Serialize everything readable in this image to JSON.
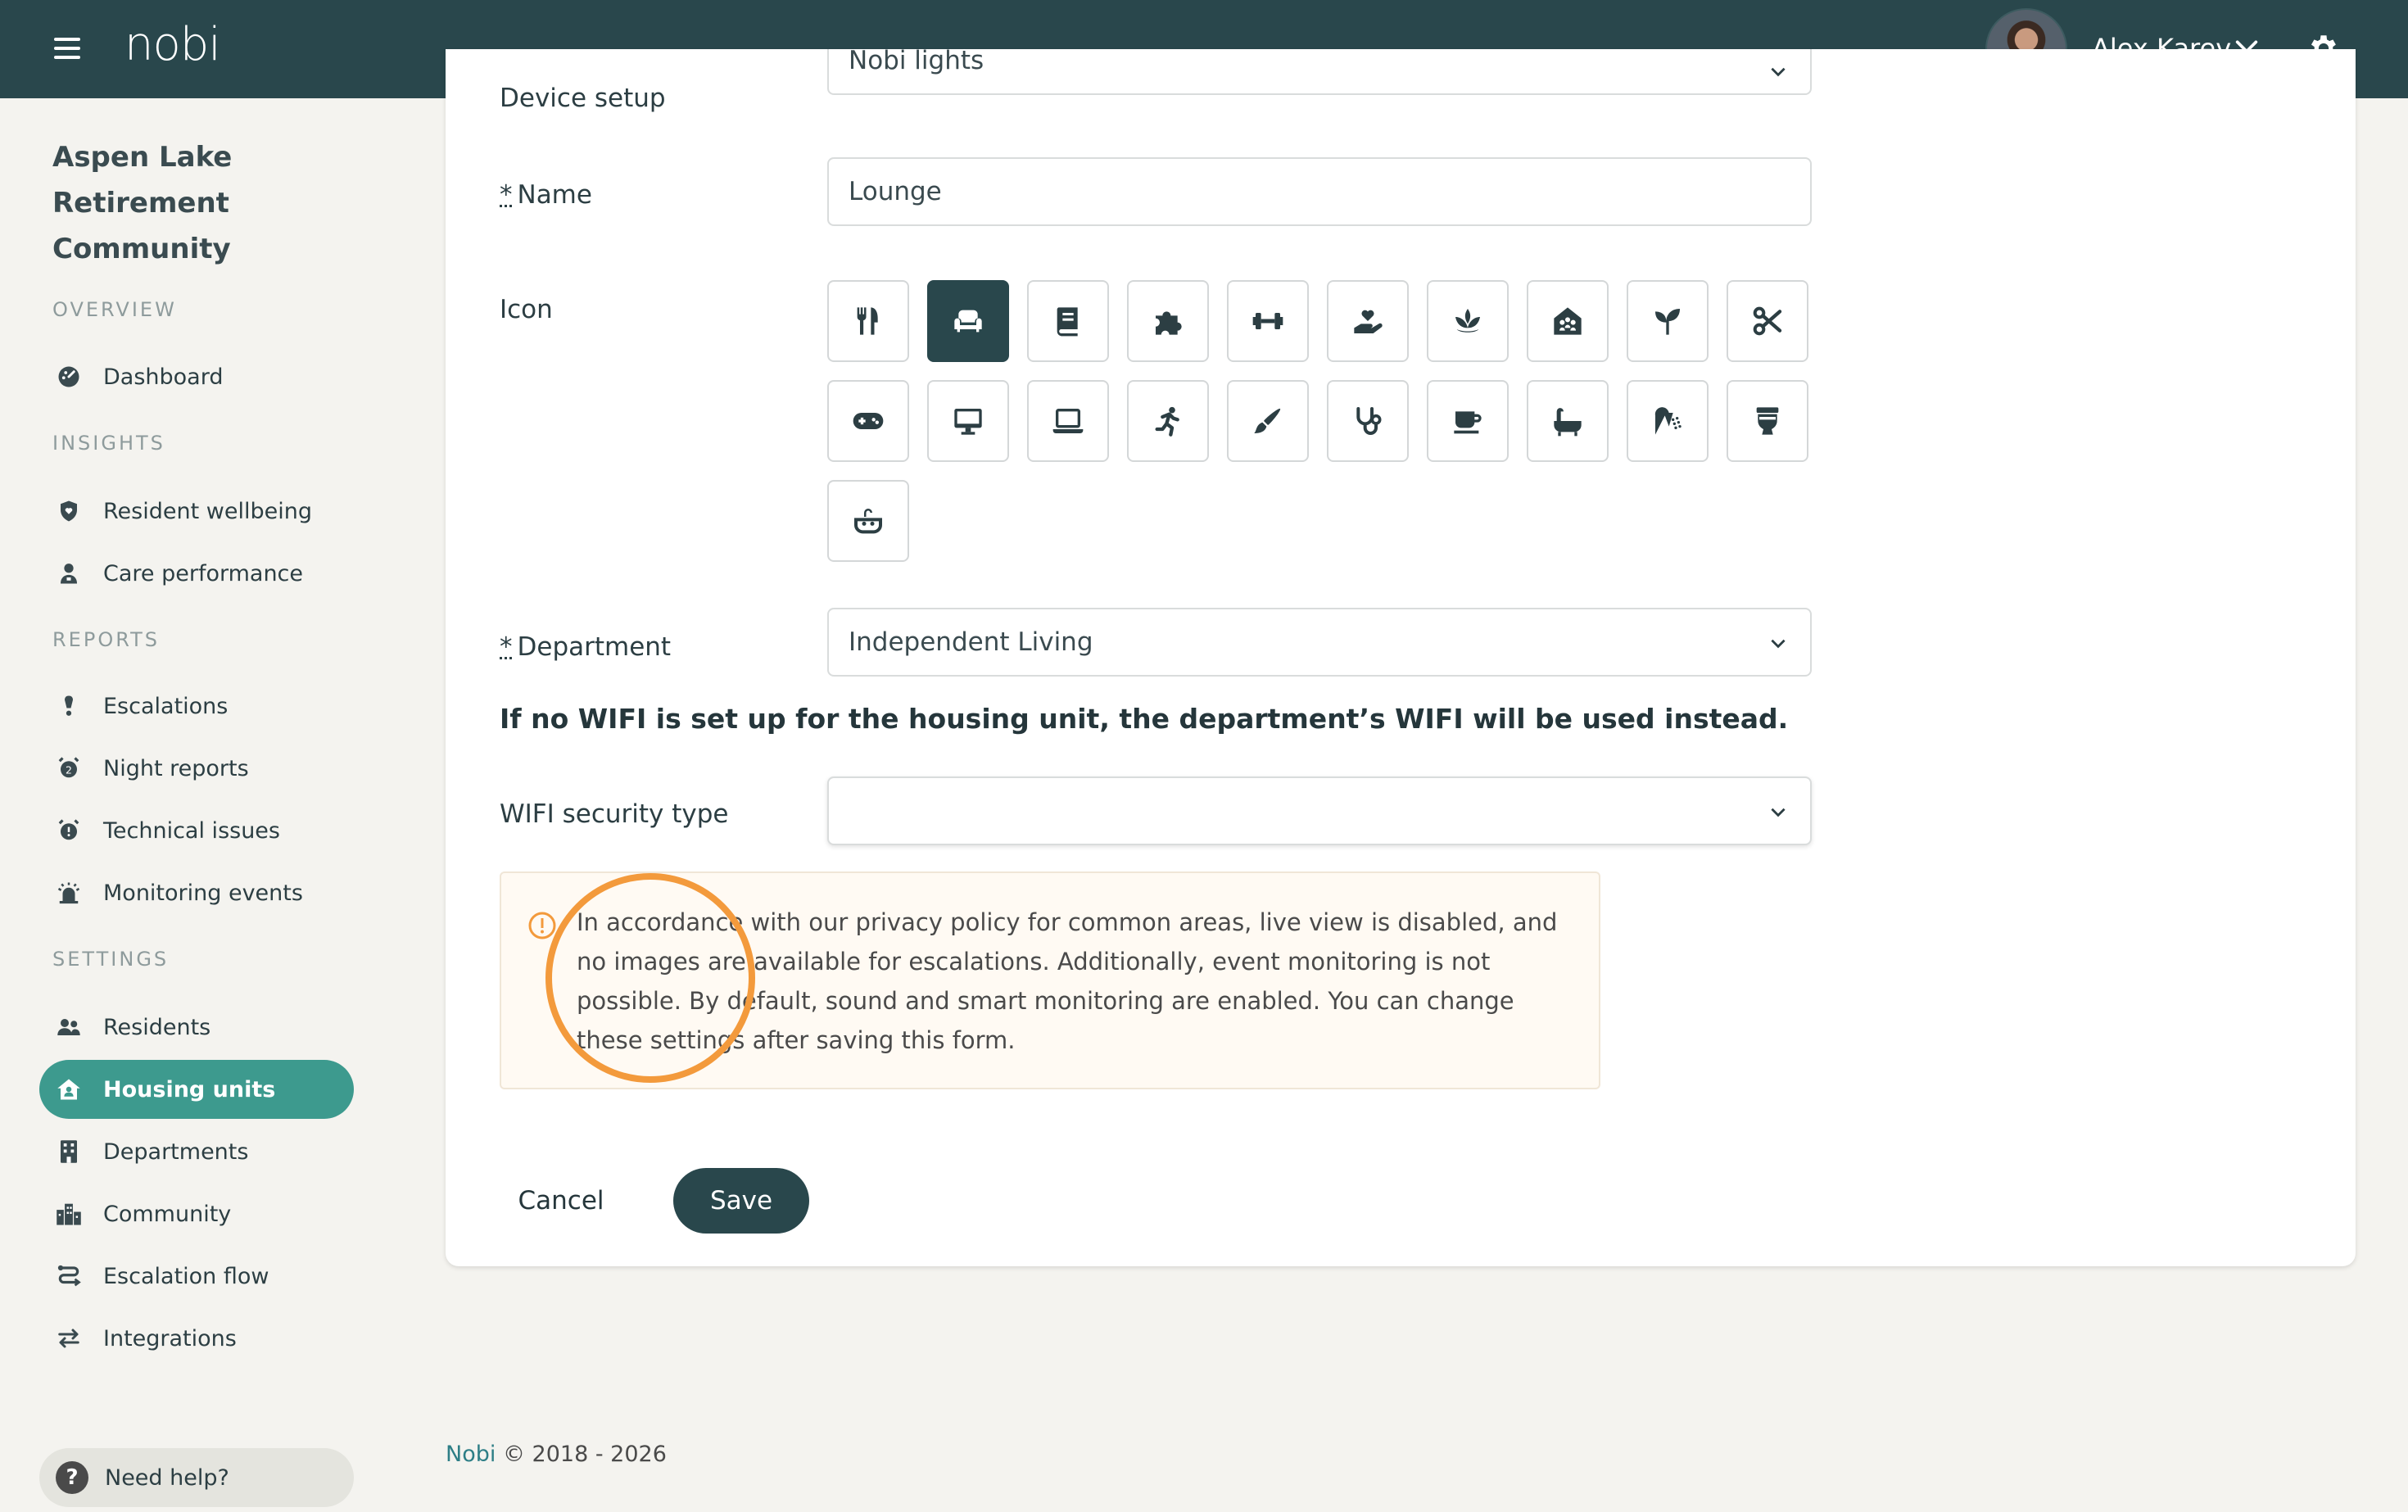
{
  "app": {
    "logo": "nobi"
  },
  "user": {
    "name": "Alex Karev"
  },
  "sidebar": {
    "community_name": "Aspen Lake Retirement Community",
    "sections": {
      "overview": "OVERVIEW",
      "insights": "INSIGHTS",
      "reports": "REPORTS",
      "settings": "SETTINGS"
    },
    "items": {
      "dashboard": "Dashboard",
      "resident_wellbeing": "Resident wellbeing",
      "care_performance": "Care performance",
      "escalations": "Escalations",
      "night_reports": "Night reports",
      "technical_issues": "Technical issues",
      "monitoring_events": "Monitoring events",
      "residents": "Residents",
      "housing_units": "Housing units",
      "departments": "Departments",
      "community": "Community",
      "escalation_flow": "Escalation flow",
      "integrations": "Integrations"
    },
    "active_item": "Housing units",
    "help": "Need help?"
  },
  "form": {
    "device_setup": {
      "label": "Device setup",
      "value": "Nobi lights"
    },
    "name": {
      "required_mark": "*",
      "label": "Name",
      "value": "Lounge"
    },
    "icon": {
      "label": "Icon",
      "selected": "sofa-icon",
      "options": [
        "fork-knife-icon",
        "sofa-icon",
        "book-icon",
        "puzzle-icon",
        "dumbbell-icon",
        "hand-heart-icon",
        "lotus-icon",
        "house-people-icon",
        "seedling-icon",
        "scissors-icon",
        "gamepad-icon",
        "desktop-icon",
        "laptop-icon",
        "running-person-icon",
        "paintbrush-icon",
        "stethoscope-icon",
        "coffee-icon",
        "bathtub-icon",
        "shower-icon",
        "toilet-icon",
        "sink-icon"
      ]
    },
    "department": {
      "required_mark": "*",
      "label": "Department",
      "value": "Independent Living"
    },
    "wifi_note": "If no WIFI is set up for the housing unit, the department’s WIFI will be used instead.",
    "wifi_security": {
      "label": "WIFI security type",
      "value": ""
    },
    "info_text": "In accordance with our privacy policy for common areas, live view is disabled, and no images are available for escalations. Additionally, event monitoring is not possible. By default, sound and smart monitoring are enabled. You can change these settings after saving this form.",
    "cancel_label": "Cancel",
    "save_label": "Save"
  },
  "footer": {
    "brand": "Nobi",
    "copyright": "© 2018 - 2026"
  },
  "colors": {
    "topbar": "#29474c",
    "accent": "#3d9a8e",
    "save_button": "#29474c",
    "annotation_circle": "#f39a3c",
    "info_background": "#fffaf3"
  }
}
